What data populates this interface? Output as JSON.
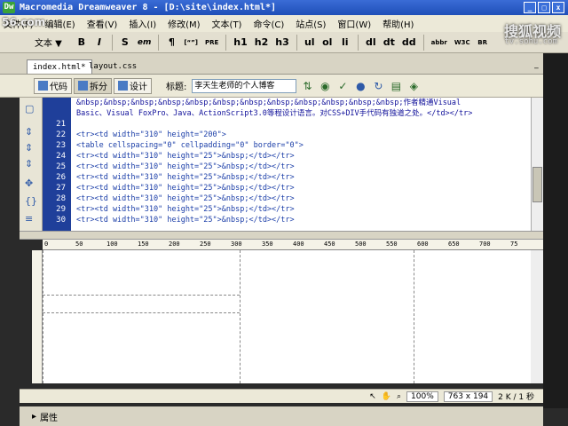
{
  "window": {
    "title": "Macromedia Dreamweaver 8 - [D:\\site\\index.html*]"
  },
  "menu": [
    "文件(F)",
    "编辑(E)",
    "查看(V)",
    "插入(I)",
    "修改(M)",
    "文本(T)",
    "命令(C)",
    "站点(S)",
    "窗口(W)",
    "帮助(H)"
  ],
  "insert_bar": {
    "category": "文本 ▼",
    "buttons": [
      "B",
      "I",
      "S",
      "em",
      "¶",
      "[“”]",
      "PRE",
      "h1",
      "h2",
      "h3",
      "ul",
      "ol",
      "li",
      "dl",
      "dt",
      "dd",
      "abbr",
      "W3C",
      "BR"
    ]
  },
  "tabs": [
    "index.html*",
    "layout.css"
  ],
  "doc_toolbar": {
    "code_label": "代码",
    "split_label": "拆分",
    "design_label": "设计",
    "title_label": "标题:",
    "title_value": "李天生老师的个人博客"
  },
  "code_lines": [
    {
      "num": "",
      "text": "&nbsp;&nbsp;&nbsp;&nbsp;&nbsp;&nbsp;&nbsp;&nbsp;&nbsp;&nbsp;&nbsp;&nbsp;作者精通Visual"
    },
    {
      "num": "",
      "text": "Basic、Visual FoxPro、Java、ActionScript3.0等程设计语言。对CSS+DIV手代码有独道之处。</td></tr>"
    },
    {
      "num": "21",
      "text": ""
    },
    {
      "num": "22",
      "text": "<tr><td width=\"310\" height=\"200\">"
    },
    {
      "num": "23",
      "text": "<table cellspacing=\"0\" cellpadding=\"0\" border=\"0\">"
    },
    {
      "num": "24",
      "text": "<tr><td width=\"310\" height=\"25\">&nbsp;</td></tr>"
    },
    {
      "num": "25",
      "text": "<tr><td width=\"310\" height=\"25\">&nbsp;</td></tr>"
    },
    {
      "num": "26",
      "text": "<tr><td width=\"310\" height=\"25\">&nbsp;</td></tr>"
    },
    {
      "num": "27",
      "text": "<tr><td width=\"310\" height=\"25\">&nbsp;</td></tr>"
    },
    {
      "num": "28",
      "text": "<tr><td width=\"310\" height=\"25\">&nbsp;</td></tr>"
    },
    {
      "num": "29",
      "text": "<tr><td width=\"310\" height=\"25\">&nbsp;</td></tr>"
    },
    {
      "num": "30",
      "text": "<tr><td width=\"310\" height=\"25\">&nbsp;</td></tr>"
    }
  ],
  "ruler_ticks": [
    "0",
    "50",
    "100",
    "150",
    "200",
    "250",
    "300",
    "350",
    "400",
    "450",
    "500",
    "550",
    "600",
    "650",
    "700",
    "75"
  ],
  "status": {
    "zoom": "100%",
    "size": "763 x 194",
    "download": "2 K / 1 秒"
  },
  "properties_label": "属性",
  "watermark": {
    "text": "搜狐视频",
    "url": "tv.sohu.com",
    "left": "56.com"
  }
}
